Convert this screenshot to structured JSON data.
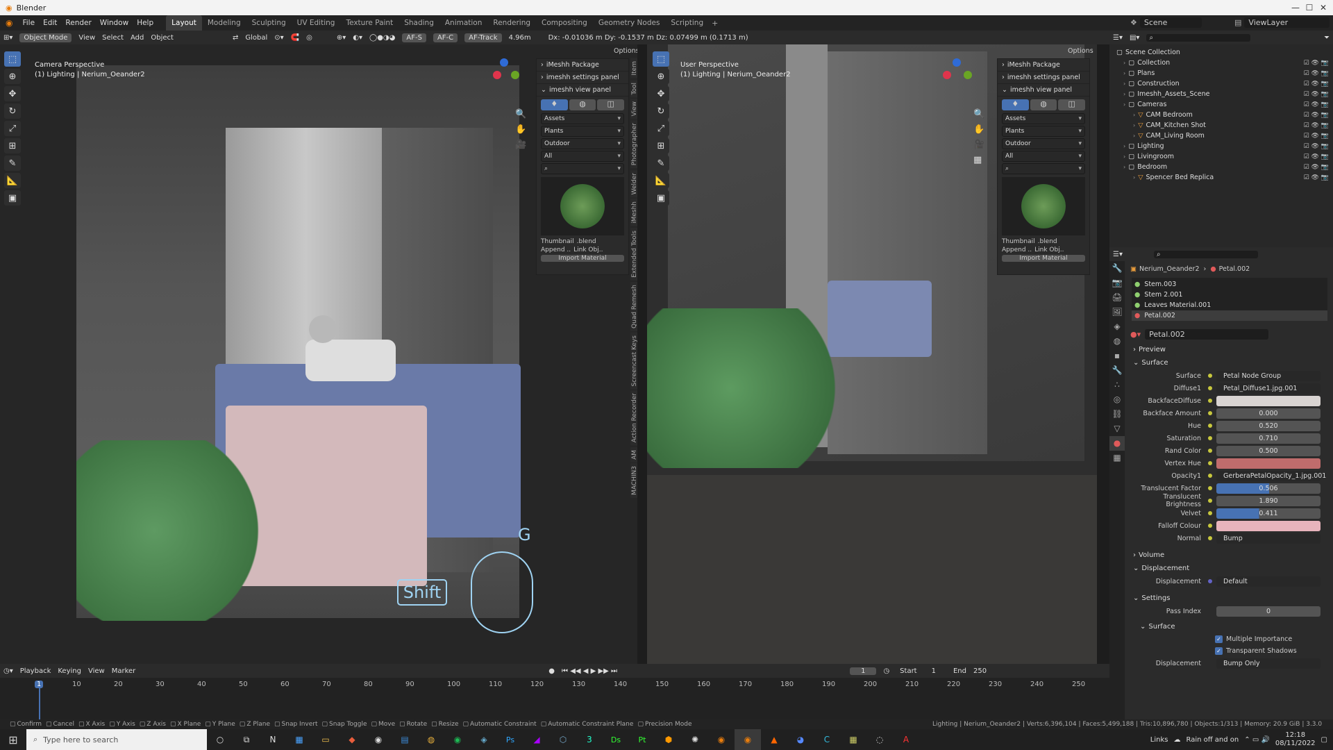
{
  "app": {
    "title": "Blender"
  },
  "menus": [
    "File",
    "Edit",
    "Render",
    "Window",
    "Help"
  ],
  "workspaces": [
    "Layout",
    "Modeling",
    "Sculpting",
    "UV Editing",
    "Texture Paint",
    "Shading",
    "Animation",
    "Rendering",
    "Compositing",
    "Geometry Nodes",
    "Scripting"
  ],
  "active_workspace": "Layout",
  "top_right": {
    "scene": "Scene",
    "viewlayer": "ViewLayer"
  },
  "header": {
    "mode": "Object Mode",
    "view": "View",
    "select": "Select",
    "add": "Add",
    "object": "Object",
    "transform": "Global",
    "af_s": "AF-S",
    "af_c": "AF-C",
    "af_track": "AF-Track",
    "focal": "4.96m",
    "status_delta": "Dx: -0.01036 m   Dy: -0.1537 m   Dz: 0.07499 m (0.1713 m)",
    "options": "Options"
  },
  "viewport_left": {
    "title": "Camera Perspective",
    "subtitle": "(1) Lighting | Nerium_Oeander2",
    "key_g": "G",
    "key_shift": "Shift"
  },
  "viewport_right": {
    "title": "User Perspective",
    "subtitle": "(1) Lighting | Nerium_Oeander2"
  },
  "imeshh": {
    "package": "iMeshh Package",
    "settings": "imeshh settings panel",
    "view": "imeshh view panel",
    "dd1": "Assets",
    "dd2": "Plants",
    "dd3": "Outdoor",
    "dd4": "All",
    "thumbnail": "Thumbnail",
    ".blend": ".blend",
    "append": "Append ..",
    "link": "Link Obj..",
    "import": "Import Material"
  },
  "side_tabs_left": [
    "Item",
    "Tool",
    "View",
    "Photographer",
    "Welder",
    "iMeshh",
    "Extended Tools",
    "Quad Remesh",
    "Screencast Keys",
    "Action Recorder",
    "AM",
    "MACHIN3"
  ],
  "outliner": {
    "items": [
      {
        "indent": 0,
        "label": "Scene Collection"
      },
      {
        "indent": 1,
        "label": "Collection"
      },
      {
        "indent": 1,
        "label": "Plans"
      },
      {
        "indent": 1,
        "label": "Construction"
      },
      {
        "indent": 1,
        "label": "Imeshh_Assets_Scene"
      },
      {
        "indent": 1,
        "label": "Cameras"
      },
      {
        "indent": 2,
        "label": "CAM Bedroom"
      },
      {
        "indent": 2,
        "label": "CAM_Kitchen Shot"
      },
      {
        "indent": 2,
        "label": "CAM_Living Room"
      },
      {
        "indent": 1,
        "label": "Lighting"
      },
      {
        "indent": 1,
        "label": "Livingroom"
      },
      {
        "indent": 1,
        "label": "Bedroom"
      },
      {
        "indent": 2,
        "label": "Spencer Bed Replica"
      }
    ]
  },
  "props": {
    "breadcrumb_obj": "Nerium_Oeander2",
    "breadcrumb_mat": "Petal.002",
    "slots": [
      "Stem.003",
      "Stem 2.001",
      "Leaves Material.001",
      "Petal.002"
    ],
    "material": "Petal.002",
    "sections": {
      "preview": "Preview",
      "surface": "Surface",
      "volume": "Volume",
      "displacement": "Displacement",
      "settings": "Settings",
      "surface2": "Surface"
    },
    "rows": [
      {
        "label": "Surface",
        "value": "Petal Node Group",
        "kind": "dark"
      },
      {
        "label": "Diffuse1",
        "value": "Petal_Diffuse1.jpg.001",
        "kind": "dark"
      },
      {
        "label": "BackfaceDiffuse",
        "value": "",
        "kind": "color",
        "color": "#d9d4d2"
      },
      {
        "label": "Backface Amount",
        "value": "0.000",
        "kind": "num"
      },
      {
        "label": "Hue",
        "value": "0.520",
        "kind": "num"
      },
      {
        "label": "Saturation",
        "value": "0.710",
        "kind": "num"
      },
      {
        "label": "Rand Color",
        "value": "0.500",
        "kind": "num"
      },
      {
        "label": "Vertex Hue",
        "value": "",
        "kind": "color",
        "color": "#c06c6c"
      },
      {
        "label": "Opacity1",
        "value": "GerberaPetalOpacity_1.jpg.001",
        "kind": "dark"
      },
      {
        "label": "Translucent Factor",
        "value": "0.506",
        "kind": "slider",
        "fill": 0.506
      },
      {
        "label": "Translucent Brightness",
        "value": "1.890",
        "kind": "num"
      },
      {
        "label": "Velvet",
        "value": "0.411",
        "kind": "slider",
        "fill": 0.411
      },
      {
        "label": "Falloff Colour",
        "value": "",
        "kind": "color",
        "color": "#e8b4bc"
      },
      {
        "label": "Normal",
        "value": "Bump",
        "kind": "dark"
      }
    ],
    "displacement_label": "Displacement",
    "displacement_value": "Default",
    "pass_index_label": "Pass Index",
    "pass_index": "0",
    "multiple_importance": "Multiple Importance",
    "transparent_shadows": "Transparent Shadows",
    "disp_method_label": "Displacement",
    "disp_method": "Bump Only"
  },
  "timeline": {
    "playback": "Playback",
    "keying": "Keying",
    "view": "View",
    "marker": "Marker",
    "current": "1",
    "start_label": "Start",
    "start": "1",
    "end_label": "End",
    "end": "250",
    "ticks": [
      "1",
      "10",
      "20",
      "30",
      "40",
      "50",
      "60",
      "70",
      "80",
      "90",
      "100",
      "110",
      "120",
      "130",
      "140",
      "150",
      "160",
      "170",
      "180",
      "190",
      "200",
      "210",
      "220",
      "230",
      "240",
      "250"
    ]
  },
  "statusbar": {
    "items": [
      "Confirm",
      "Cancel",
      "X Axis",
      "Y Axis",
      "Z Axis",
      "X Plane",
      "Y Plane",
      "Z Plane",
      "Snap Invert",
      "Snap Toggle",
      "Move",
      "Rotate",
      "Resize",
      "Automatic Constraint",
      "Automatic Constraint Plane",
      "Precision Mode"
    ],
    "stats": "Lighting | Nerium_Oeander2 | Verts:6,396,104 | Faces:5,499,188 | Tris:10,896,780 | Objects:1/313 | Memory: 20.9 GiB | 3.3.0"
  },
  "taskbar": {
    "search": "Type here to search",
    "links": "Links",
    "weather": "Rain off and on",
    "time": "12:18",
    "date": "08/11/2022"
  }
}
